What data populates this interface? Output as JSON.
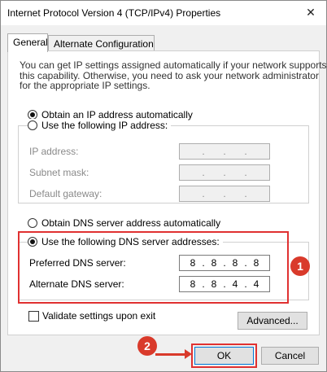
{
  "window": {
    "title": "Internet Protocol Version 4 (TCP/IPv4) Properties",
    "close_glyph": "✕"
  },
  "tabs": [
    {
      "label": "General",
      "active": true
    },
    {
      "label": "Alternate Configuration",
      "active": false
    }
  ],
  "description": [
    "You can get IP settings assigned automatically if your network supports",
    "this capability. Otherwise, you need to ask your network administrator",
    "for the appropriate IP settings."
  ],
  "ip": {
    "auto_label": "Obtain an IP address automatically",
    "auto_checked": true,
    "manual_label": "Use the following IP address:",
    "manual_checked": false,
    "fields": [
      {
        "label": "IP address:",
        "octets": [
          "",
          "",
          "",
          ""
        ]
      },
      {
        "label": "Subnet mask:",
        "octets": [
          "",
          "",
          "",
          ""
        ]
      },
      {
        "label": "Default gateway:",
        "octets": [
          "",
          "",
          "",
          ""
        ]
      }
    ]
  },
  "dns": {
    "auto_label": "Obtain DNS server address automatically",
    "auto_checked": false,
    "manual_label": "Use the following DNS server addresses:",
    "manual_checked": true,
    "fields": [
      {
        "label": "Preferred DNS server:",
        "octets": [
          "8",
          "8",
          "8",
          "8"
        ]
      },
      {
        "label": "Alternate DNS server:",
        "octets": [
          "8",
          "8",
          "4",
          "4"
        ]
      }
    ]
  },
  "validate": {
    "label": "Validate settings upon exit",
    "checked": false
  },
  "buttons": {
    "advanced": "Advanced...",
    "ok": "OK",
    "cancel": "Cancel"
  },
  "annotations": {
    "step1": "1",
    "step2": "2",
    "highlight_color": "#e03131"
  },
  "octet_separator": "."
}
